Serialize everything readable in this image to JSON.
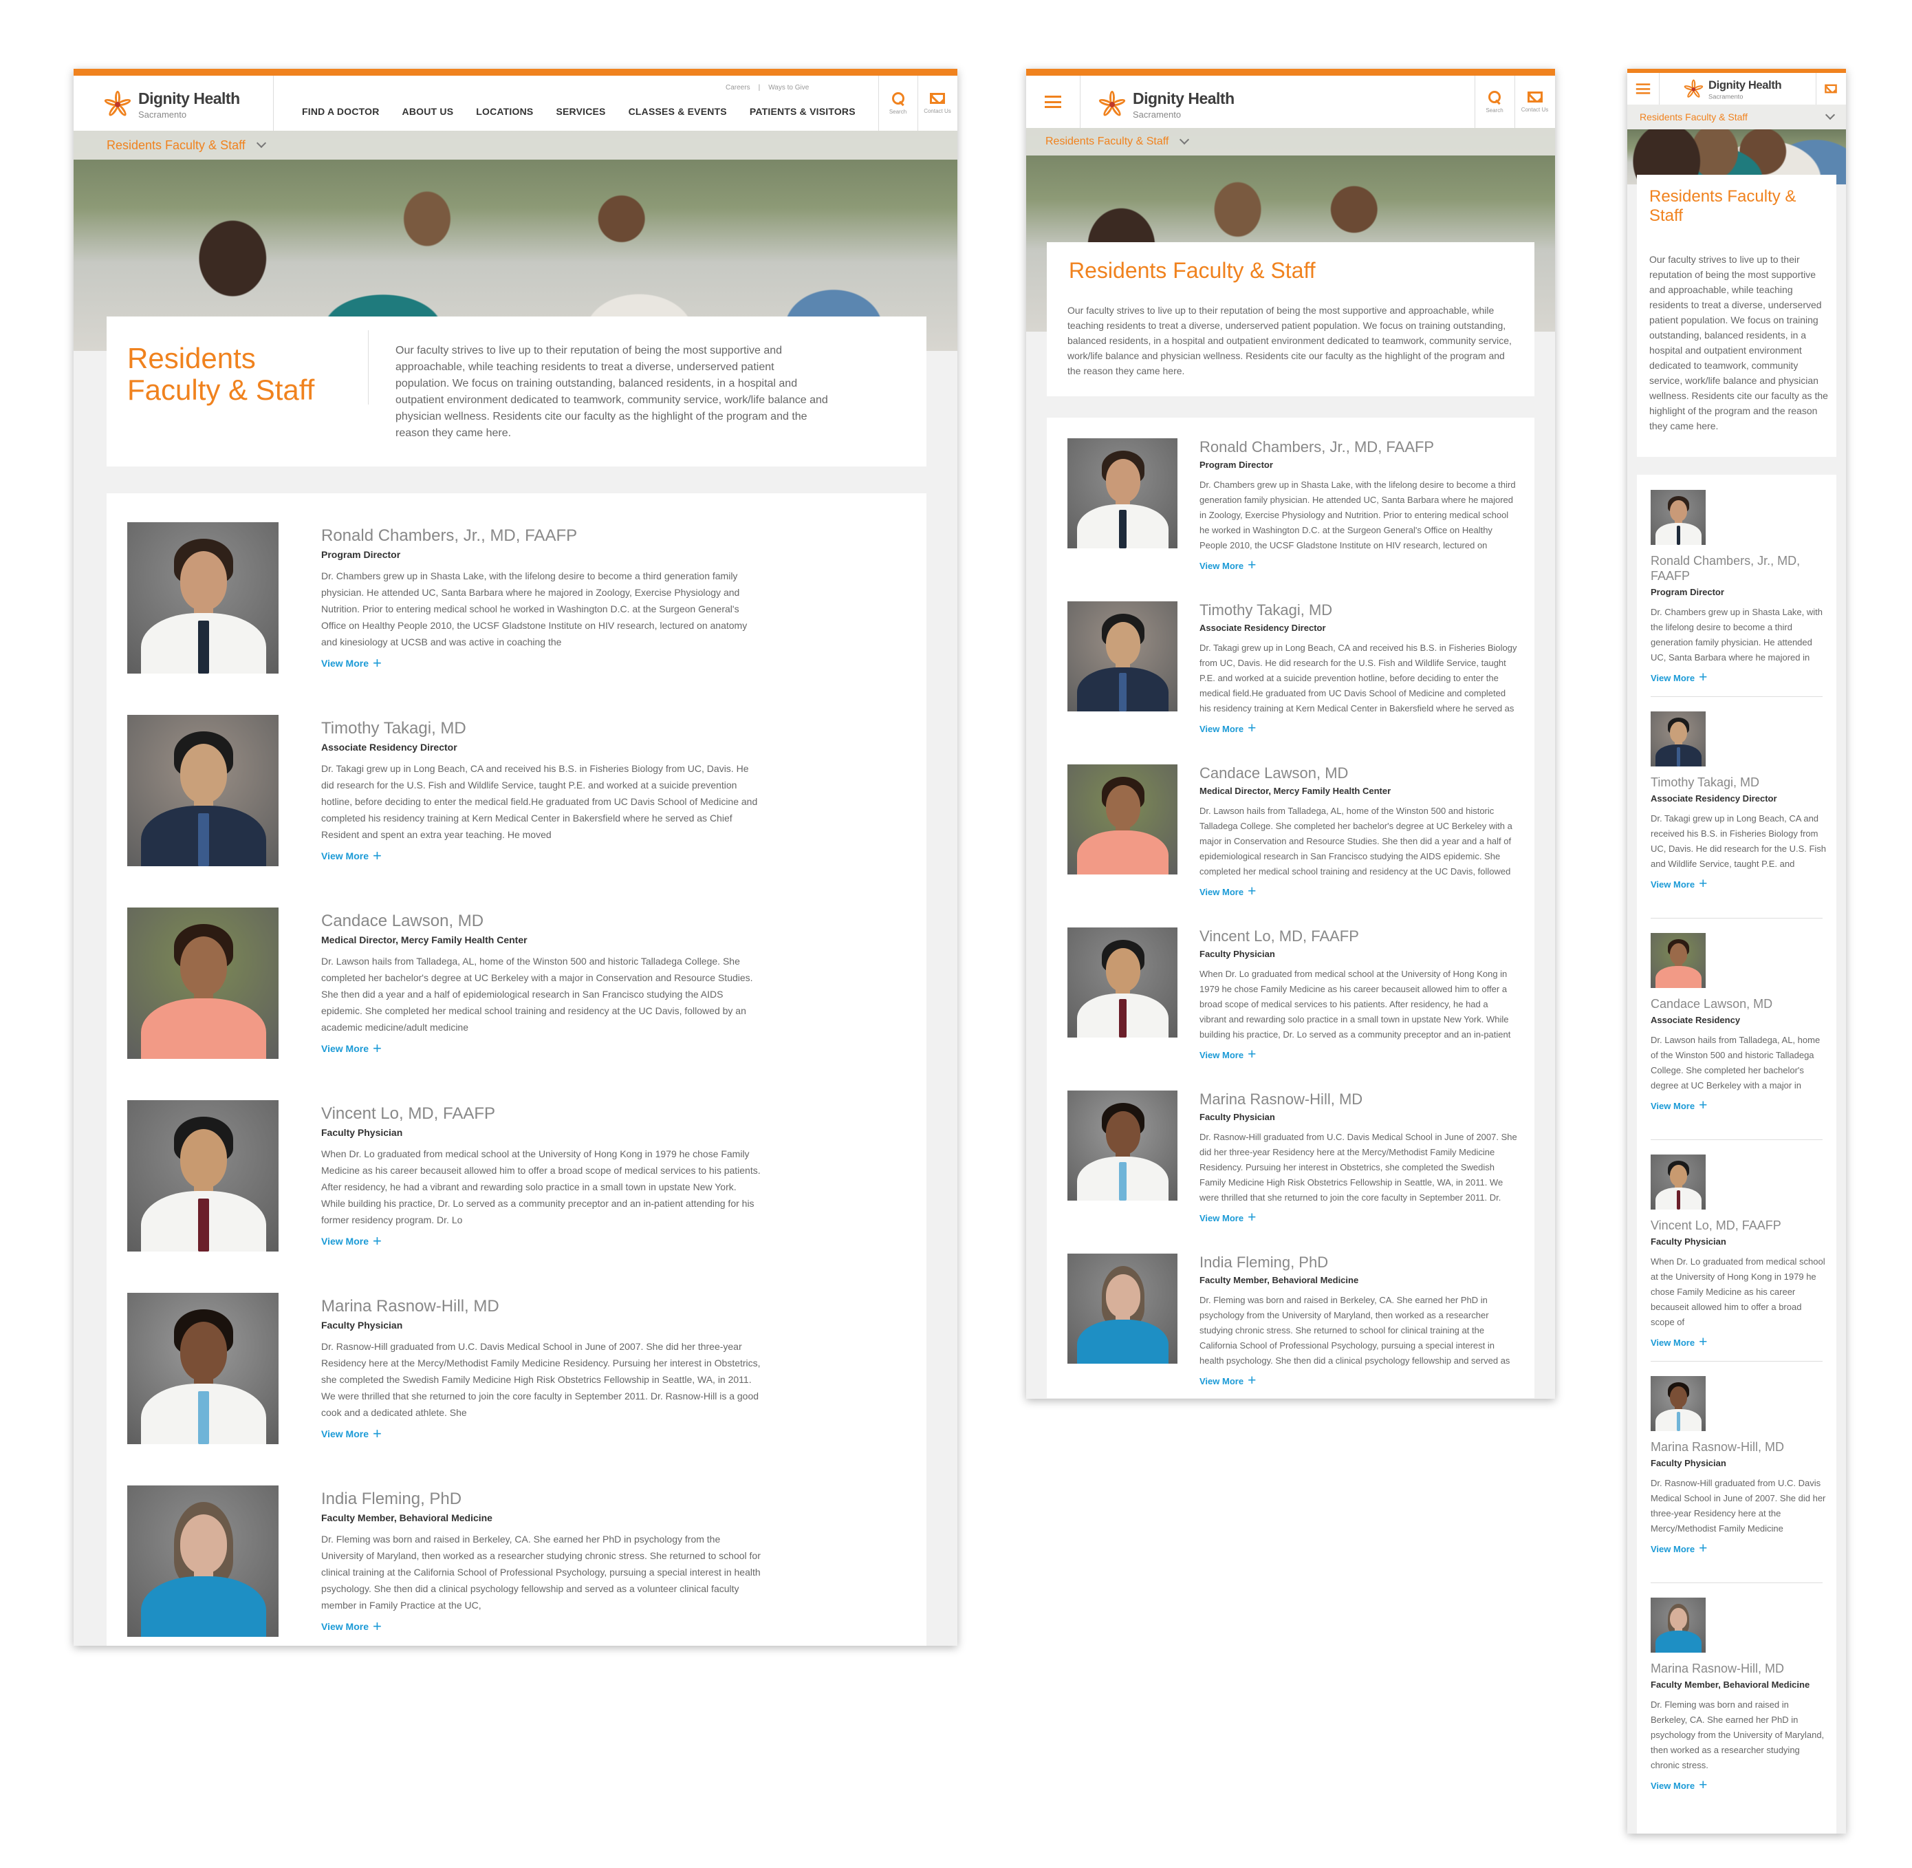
{
  "brand": {
    "name": "Dignity Health",
    "location": "Sacramento"
  },
  "nav": {
    "items": [
      "FIND A DOCTOR",
      "ABOUT US",
      "LOCATIONS",
      "SERVICES",
      "CLASSES & EVENTS",
      "PATIENTS & VISITORS"
    ],
    "utility": [
      "Careers",
      "|",
      "Ways to Give"
    ],
    "search_label": "Search",
    "contact_label": "Contact Us"
  },
  "section": {
    "dropdown_label": "Residents Faculty & Staff"
  },
  "page": {
    "title": "Residents Faculty & Staff",
    "intro": "Our faculty strives to live up to their reputation of being the most supportive and approachable, while teaching residents to treat a diverse, underserved patient population. We focus on training outstanding, balanced residents, in a hospital and outpatient environment dedicated to teamwork, community service, work/life balance and physician wellness. Residents cite our faculty as the highlight of the program and the reason they came here."
  },
  "view_more": "View More",
  "people": [
    {
      "name": "Ronald Chambers, Jr., MD, FAAFP",
      "role": "Program Director",
      "bio": "Dr. Chambers grew up in Shasta Lake, with the lifelong desire to become a third generation family physician. He attended UC, Santa Barbara where he majored in Zoology, Exercise Physiology and Nutrition. Prior to entering medical school he worked in Washington D.C. at the Surgeon General's Office on Healthy People 2010, the UCSF Gladstone Institute on HIV research, lectured on anatomy and kinesiology at UCSB and was active in coaching the"
    },
    {
      "name": "Timothy Takagi, MD",
      "role": "Associate Residency Director",
      "bio": "Dr. Takagi grew up in Long Beach, CA and received his B.S. in Fisheries Biology from UC, Davis. He did research for the U.S. Fish and Wildlife Service, taught P.E. and worked at a suicide prevention hotline, before deciding to enter the medical field.He graduated from UC Davis School of Medicine and completed his residency training at Kern Medical Center in Bakersfield where he served as Chief Resident and spent an extra year teaching. He moved"
    },
    {
      "name": "Candace Lawson, MD",
      "role": "Medical Director, Mercy Family Health Center",
      "bio": "Dr. Lawson hails from Talladega, AL, home of the Winston 500 and historic Talladega College. She completed her bachelor's degree at UC Berkeley with a major in Conservation and Resource Studies. She then did a year and a half of epidemiological research in San Francisco studying the AIDS epidemic. She completed her medical school training and residency at the UC Davis, followed by an academic medicine/adult medicine"
    },
    {
      "name": "Vincent Lo, MD, FAAFP",
      "role": "Faculty Physician",
      "bio": "When Dr. Lo graduated from medical school at the University of Hong Kong in 1979 he chose Family Medicine as his career becauseit allowed him to offer a broad scope of medical services to his patients. After residency, he had a vibrant and rewarding solo practice in a small town in upstate New York. While building his practice, Dr. Lo served as a community preceptor and an in-patient attending for his former residency program. Dr. Lo"
    },
    {
      "name": "Marina Rasnow-Hill, MD",
      "role": "Faculty Physician",
      "bio": "Dr. Rasnow-Hill graduated from U.C. Davis Medical School in June of 2007. She did her three-year Residency here at the Mercy/Methodist Family Medicine Residency. Pursuing her interest in Obstetrics, she completed the Swedish Family Medicine High Risk Obstetrics Fellowship in Seattle, WA, in 2011. We were thrilled that she returned to join the core faculty in September 2011. Dr. Rasnow-Hill is a good cook and a dedicated athlete. She"
    },
    {
      "name": "India Fleming, PhD",
      "role": "Faculty Member, Behavioral Medicine",
      "bio": "Dr. Fleming was born and raised in Berkeley, CA. She earned her PhD in psychology from the University of Maryland, then worked as a researcher studying chronic stress. She returned to school for clinical training at the California School of Professional Psychology, pursuing a special interest in health psychology. She then did a clinical psychology fellowship and served as a volunteer clinical faculty member in Family Practice at the UC,"
    }
  ],
  "mobile_people": [
    {
      "name": "Ronald Chambers, Jr., MD, FAAFP",
      "role": "Program Director",
      "bio": "Dr. Chambers grew up in Shasta Lake, with the lifelong desire to become a third generation family physician. He attended UC, Santa Barbara where he majored in"
    },
    {
      "name": "Timothy Takagi, MD",
      "role": "Associate Residency Director",
      "bio": "Dr. Takagi grew up in Long Beach, CA and received his B.S. in Fisheries Biology from UC, Davis. He did research for the U.S. Fish and Wildlife Service, taught P.E. and"
    },
    {
      "name": "Candace Lawson, MD",
      "role": "Associate Residency",
      "bio": "Dr. Lawson hails from Talladega, AL, home of the Winston 500 and historic Talladega College. She completed her bachelor's degree at UC Berkeley with a major in"
    },
    {
      "name": "Vincent Lo, MD, FAAFP",
      "role": "Faculty Physician",
      "bio": "When Dr. Lo graduated from medical school at the University of Hong Kong in 1979 he chose Family Medicine as his career becauseit allowed him to offer a broad scope of"
    },
    {
      "name": "Marina Rasnow-Hill, MD",
      "role": "Faculty Physician",
      "bio": "Dr. Rasnow-Hill graduated from U.C. Davis Medical School in June of 2007. She did her three-year Residency here at the Mercy/Methodist Family Medicine"
    },
    {
      "name": "Marina Rasnow-Hill, MD",
      "role": "Faculty Member, Behavioral Medicine",
      "bio": "Dr. Fleming was born and raised in Berkeley, CA. She earned her PhD in psychology from the University of Maryland, then worked as a researcher studying chronic stress."
    }
  ],
  "colors": {
    "accent": "#f0821e",
    "link": "#1b9ad6",
    "text": "#666666",
    "panel_bg": "#f1f1f1"
  },
  "icons": {
    "search": "search-icon",
    "contact": "mail-icon",
    "menu": "hamburger-menu-icon",
    "dropdown": "chevron-down-icon",
    "logo": "dignity-health-logo-mark"
  }
}
